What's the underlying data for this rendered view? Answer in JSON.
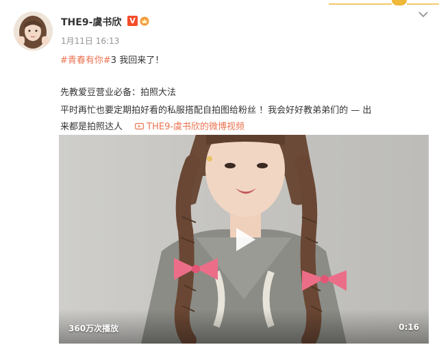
{
  "post": {
    "username": "THE9-虞书欣",
    "verified_badge": "V",
    "timestamp": "1月11日 16:13",
    "line1": {
      "hashtag": "#青春有你#",
      "rest": "3 我回来了！"
    },
    "line2": "先教爱豆营业必备：拍照大法",
    "line3": "平时再忙也要定期拍好看的私服搭配自拍图给粉丝 ！我会好好教弟弟们的 — 出",
    "line4_text": "来都是拍照达人",
    "video_link_label": "THE9-虞书欣的微博视频"
  },
  "video": {
    "views_label": "360万次播放",
    "duration": "0:16"
  },
  "icons": {
    "more": "chevron-down-icon",
    "play": "play-icon",
    "video_link": "video-camera-icon",
    "vip": "vip-crown-icon"
  },
  "colors": {
    "accent": "#eb7350",
    "verified": "#f44c2a",
    "text": "#333333",
    "muted": "#939393"
  }
}
